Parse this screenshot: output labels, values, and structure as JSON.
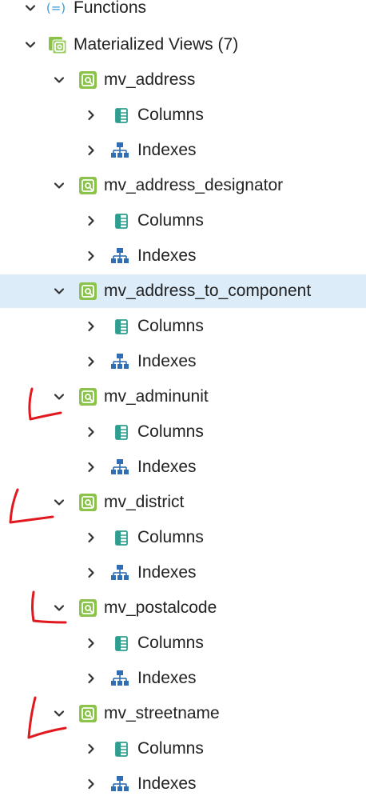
{
  "tree": {
    "functions_label": "Functions",
    "materialized_views_label": "Materialized Views (7)",
    "columns_label": "Columns",
    "indexes_label": "Indexes",
    "views": [
      {
        "name": "mv_address"
      },
      {
        "name": "mv_address_designator"
      },
      {
        "name": "mv_address_to_component"
      },
      {
        "name": "mv_adminunit"
      },
      {
        "name": "mv_district"
      },
      {
        "name": "mv_postalcode"
      },
      {
        "name": "mv_streetname"
      }
    ]
  },
  "colors": {
    "selection": "#dcecf8",
    "mv_icon": "#8bc34a",
    "columns_icon": "#2e9e8e",
    "indexes_icon": "#2f6db5",
    "annotation": "#e0191f"
  },
  "icons": {
    "expanded": "chevron-down-icon",
    "collapsed": "chevron-right-icon",
    "materialized_view": "materialized-view-icon",
    "columns": "columns-icon",
    "indexes": "indexes-icon",
    "functions": "functions-icon"
  }
}
